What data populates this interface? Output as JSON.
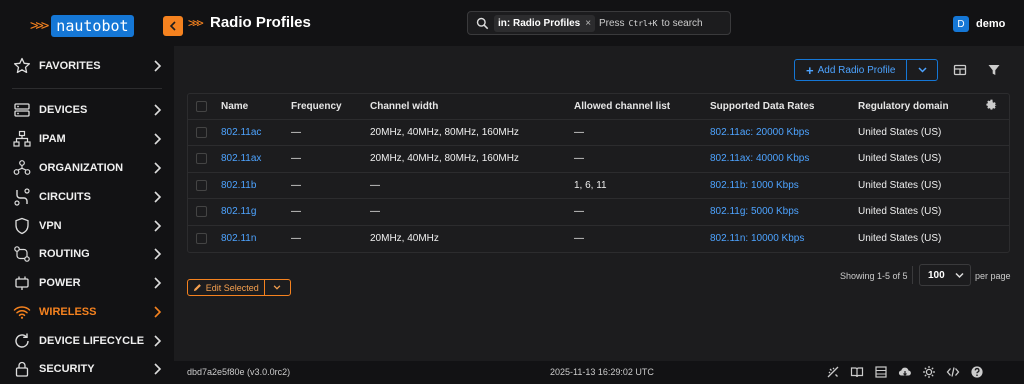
{
  "brand": {
    "arrows": ">>>",
    "name": "nautobot"
  },
  "sidebar": {
    "items": [
      {
        "label": "FAVORITES",
        "icon": "star-icon"
      },
      {
        "label": "DEVICES",
        "icon": "server-icon"
      },
      {
        "label": "IPAM",
        "icon": "network-tree-icon"
      },
      {
        "label": "ORGANIZATION",
        "icon": "organization-icon"
      },
      {
        "label": "CIRCUITS",
        "icon": "circuit-icon"
      },
      {
        "label": "VPN",
        "icon": "shield-icon"
      },
      {
        "label": "ROUTING",
        "icon": "routing-icon"
      },
      {
        "label": "POWER",
        "icon": "power-icon"
      },
      {
        "label": "WIRELESS",
        "icon": "wifi-icon",
        "active": true
      },
      {
        "label": "DEVICE LIFECYCLE",
        "icon": "lifecycle-icon"
      },
      {
        "label": "SECURITY",
        "icon": "lock-icon"
      }
    ]
  },
  "header": {
    "title_arrows": ">>>",
    "title": "Radio Profiles"
  },
  "search": {
    "scope_prefix": "in:",
    "scope_value": "Radio Profiles",
    "scope_close": "×",
    "hint_pre": "Press",
    "hint_key": "Ctrl+K",
    "hint_post": "to search"
  },
  "user": {
    "initial": "D",
    "name": "demo"
  },
  "actions": {
    "add_label": "Add Radio Profile",
    "add_plus": "+"
  },
  "table": {
    "columns": [
      "Name",
      "Frequency",
      "Channel width",
      "Allowed channel list",
      "Supported Data Rates",
      "Regulatory domain"
    ],
    "rows": [
      {
        "name": "802.11ac",
        "frequency": "—",
        "channel_width": "20MHz, 40MHz, 80MHz, 160MHz",
        "allowed": "—",
        "rates": "802.11ac: 20000 Kbps",
        "domain": "United States (US)"
      },
      {
        "name": "802.11ax",
        "frequency": "—",
        "channel_width": "20MHz, 40MHz, 80MHz, 160MHz",
        "allowed": "—",
        "rates": "802.11ax: 40000 Kbps",
        "domain": "United States (US)"
      },
      {
        "name": "802.11b",
        "frequency": "—",
        "channel_width": "—",
        "allowed": "1, 6, 11",
        "rates": "802.11b: 1000 Kbps",
        "domain": "United States (US)"
      },
      {
        "name": "802.11g",
        "frequency": "—",
        "channel_width": "—",
        "allowed": "—",
        "rates": "802.11g: 5000 Kbps",
        "domain": "United States (US)"
      },
      {
        "name": "802.11n",
        "frequency": "—",
        "channel_width": "20MHz, 40MHz",
        "allowed": "—",
        "rates": "802.11n: 10000 Kbps",
        "domain": "United States (US)"
      }
    ]
  },
  "pagination": {
    "showing": "Showing 1-5 of 5",
    "per_page_value": "100",
    "per_page_label": "per page"
  },
  "bulk": {
    "edit_label": "Edit Selected"
  },
  "footer": {
    "version": "dbd7a2e5f80e (v3.0.0rc2)",
    "timestamp": "2025-11-13 16:29:02 UTC"
  },
  "colors": {
    "accent": "#f5821f",
    "link": "#4da3ff",
    "brand_blue": "#1577d6"
  }
}
